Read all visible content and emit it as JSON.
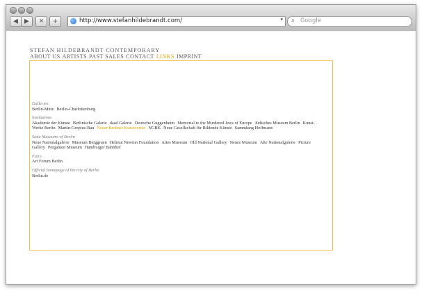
{
  "browser": {
    "url": "http://www.stefanhildebrandt.com/",
    "search_placeholder": "Google",
    "back": "◀",
    "forward": "▶",
    "stop": "✕",
    "add": "+"
  },
  "site": {
    "brand": "STEFAN HILDEBRANDT CONTEMPORARY",
    "nav": [
      {
        "label": "ABOUT US",
        "active": false
      },
      {
        "label": "ARTISTS",
        "active": false
      },
      {
        "label": "PAST SALES",
        "active": false
      },
      {
        "label": "CONTACT",
        "active": false
      },
      {
        "label": "LINKS",
        "active": true
      },
      {
        "label": "IMPRINT",
        "active": false
      }
    ]
  },
  "sections": [
    {
      "heading": "Galleries",
      "links": [
        "Berlin-Mitte",
        "Berlin-Charlottenburg"
      ]
    },
    {
      "heading": "Institutions",
      "links": [
        "Akademie der Künste",
        "Berlinische Galerie",
        "daad Galerie",
        "Deutsche Guggenheim",
        "Memorial to the Murdered Jews of Europe",
        "Jüdisches Museum Berlin",
        "Kunst-Werke Berlin",
        "Martin-Gropius-Bau",
        "Neuer Berliner Kunstverein",
        "NGBK",
        "Neue Gesellschaft für Bildende Künste",
        "Sammlung Hoffmann"
      ],
      "highlight": "Neuer Berliner Kunstverein"
    },
    {
      "heading": "State Museums of Berlin",
      "links": [
        "Neue Nationalgalerie",
        "Museum Berggruen",
        "Helmut Newton Foundation",
        "Altes Museum",
        "Old National Gallery",
        "Neues Museum",
        "Alte Nationalgalerie",
        "Picture Gallery",
        "Pergamon Museum",
        "Hamburger Bahnhof"
      ]
    },
    {
      "heading": "Fairs",
      "links": [
        "Art Forum Berlin"
      ]
    },
    {
      "heading": "Official homepage of the city of Berlin",
      "links": [
        "Berlin.de"
      ]
    }
  ],
  "colors": {
    "accent": "#e0a100",
    "frame": "#f2c14e"
  }
}
